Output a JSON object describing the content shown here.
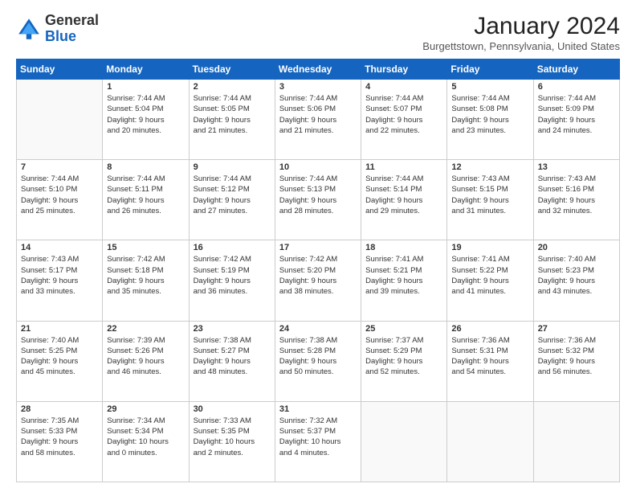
{
  "logo": {
    "line1": "General",
    "line2": "Blue"
  },
  "title": "January 2024",
  "location": "Burgettstown, Pennsylvania, United States",
  "days_of_week": [
    "Sunday",
    "Monday",
    "Tuesday",
    "Wednesday",
    "Thursday",
    "Friday",
    "Saturday"
  ],
  "weeks": [
    [
      {
        "day": "",
        "text": ""
      },
      {
        "day": "1",
        "text": "Sunrise: 7:44 AM\nSunset: 5:04 PM\nDaylight: 9 hours\nand 20 minutes."
      },
      {
        "day": "2",
        "text": "Sunrise: 7:44 AM\nSunset: 5:05 PM\nDaylight: 9 hours\nand 21 minutes."
      },
      {
        "day": "3",
        "text": "Sunrise: 7:44 AM\nSunset: 5:06 PM\nDaylight: 9 hours\nand 21 minutes."
      },
      {
        "day": "4",
        "text": "Sunrise: 7:44 AM\nSunset: 5:07 PM\nDaylight: 9 hours\nand 22 minutes."
      },
      {
        "day": "5",
        "text": "Sunrise: 7:44 AM\nSunset: 5:08 PM\nDaylight: 9 hours\nand 23 minutes."
      },
      {
        "day": "6",
        "text": "Sunrise: 7:44 AM\nSunset: 5:09 PM\nDaylight: 9 hours\nand 24 minutes."
      }
    ],
    [
      {
        "day": "7",
        "text": "Sunrise: 7:44 AM\nSunset: 5:10 PM\nDaylight: 9 hours\nand 25 minutes."
      },
      {
        "day": "8",
        "text": "Sunrise: 7:44 AM\nSunset: 5:11 PM\nDaylight: 9 hours\nand 26 minutes."
      },
      {
        "day": "9",
        "text": "Sunrise: 7:44 AM\nSunset: 5:12 PM\nDaylight: 9 hours\nand 27 minutes."
      },
      {
        "day": "10",
        "text": "Sunrise: 7:44 AM\nSunset: 5:13 PM\nDaylight: 9 hours\nand 28 minutes."
      },
      {
        "day": "11",
        "text": "Sunrise: 7:44 AM\nSunset: 5:14 PM\nDaylight: 9 hours\nand 29 minutes."
      },
      {
        "day": "12",
        "text": "Sunrise: 7:43 AM\nSunset: 5:15 PM\nDaylight: 9 hours\nand 31 minutes."
      },
      {
        "day": "13",
        "text": "Sunrise: 7:43 AM\nSunset: 5:16 PM\nDaylight: 9 hours\nand 32 minutes."
      }
    ],
    [
      {
        "day": "14",
        "text": "Sunrise: 7:43 AM\nSunset: 5:17 PM\nDaylight: 9 hours\nand 33 minutes."
      },
      {
        "day": "15",
        "text": "Sunrise: 7:42 AM\nSunset: 5:18 PM\nDaylight: 9 hours\nand 35 minutes."
      },
      {
        "day": "16",
        "text": "Sunrise: 7:42 AM\nSunset: 5:19 PM\nDaylight: 9 hours\nand 36 minutes."
      },
      {
        "day": "17",
        "text": "Sunrise: 7:42 AM\nSunset: 5:20 PM\nDaylight: 9 hours\nand 38 minutes."
      },
      {
        "day": "18",
        "text": "Sunrise: 7:41 AM\nSunset: 5:21 PM\nDaylight: 9 hours\nand 39 minutes."
      },
      {
        "day": "19",
        "text": "Sunrise: 7:41 AM\nSunset: 5:22 PM\nDaylight: 9 hours\nand 41 minutes."
      },
      {
        "day": "20",
        "text": "Sunrise: 7:40 AM\nSunset: 5:23 PM\nDaylight: 9 hours\nand 43 minutes."
      }
    ],
    [
      {
        "day": "21",
        "text": "Sunrise: 7:40 AM\nSunset: 5:25 PM\nDaylight: 9 hours\nand 45 minutes."
      },
      {
        "day": "22",
        "text": "Sunrise: 7:39 AM\nSunset: 5:26 PM\nDaylight: 9 hours\nand 46 minutes."
      },
      {
        "day": "23",
        "text": "Sunrise: 7:38 AM\nSunset: 5:27 PM\nDaylight: 9 hours\nand 48 minutes."
      },
      {
        "day": "24",
        "text": "Sunrise: 7:38 AM\nSunset: 5:28 PM\nDaylight: 9 hours\nand 50 minutes."
      },
      {
        "day": "25",
        "text": "Sunrise: 7:37 AM\nSunset: 5:29 PM\nDaylight: 9 hours\nand 52 minutes."
      },
      {
        "day": "26",
        "text": "Sunrise: 7:36 AM\nSunset: 5:31 PM\nDaylight: 9 hours\nand 54 minutes."
      },
      {
        "day": "27",
        "text": "Sunrise: 7:36 AM\nSunset: 5:32 PM\nDaylight: 9 hours\nand 56 minutes."
      }
    ],
    [
      {
        "day": "28",
        "text": "Sunrise: 7:35 AM\nSunset: 5:33 PM\nDaylight: 9 hours\nand 58 minutes."
      },
      {
        "day": "29",
        "text": "Sunrise: 7:34 AM\nSunset: 5:34 PM\nDaylight: 10 hours\nand 0 minutes."
      },
      {
        "day": "30",
        "text": "Sunrise: 7:33 AM\nSunset: 5:35 PM\nDaylight: 10 hours\nand 2 minutes."
      },
      {
        "day": "31",
        "text": "Sunrise: 7:32 AM\nSunset: 5:37 PM\nDaylight: 10 hours\nand 4 minutes."
      },
      {
        "day": "",
        "text": ""
      },
      {
        "day": "",
        "text": ""
      },
      {
        "day": "",
        "text": ""
      }
    ]
  ]
}
